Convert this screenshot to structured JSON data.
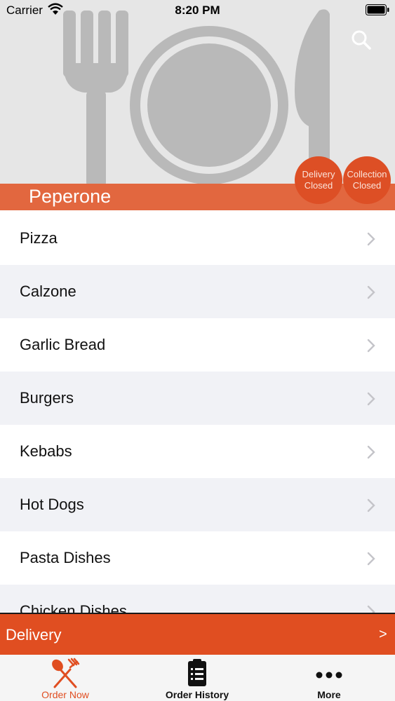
{
  "status_bar": {
    "carrier": "Carrier",
    "time": "8:20 PM"
  },
  "header": {
    "restaurant_name": "Peperone",
    "delivery_status": {
      "line1": "Delivery",
      "line2": "Closed"
    },
    "collection_status": {
      "line1": "Collection",
      "line2": "Closed"
    },
    "search_icon": "search-icon"
  },
  "categories": [
    {
      "label": "Pizza"
    },
    {
      "label": "Calzone"
    },
    {
      "label": "Garlic Bread"
    },
    {
      "label": "Burgers"
    },
    {
      "label": "Kebabs"
    },
    {
      "label": "Hot Dogs"
    },
    {
      "label": "Pasta Dishes"
    },
    {
      "label": "Chicken Dishes"
    }
  ],
  "delivery_bar": {
    "label": "Delivery",
    "arrow": ">"
  },
  "tabs": [
    {
      "label": "Order Now",
      "icon": "fork-knife-icon",
      "active": true
    },
    {
      "label": "Order History",
      "icon": "clipboard-list-icon",
      "active": false
    },
    {
      "label": "More",
      "icon": "more-dots-icon",
      "active": false
    }
  ],
  "colors": {
    "accent": "#e04e21",
    "band": "#e2673f",
    "header_bg": "#e6e6e6"
  }
}
